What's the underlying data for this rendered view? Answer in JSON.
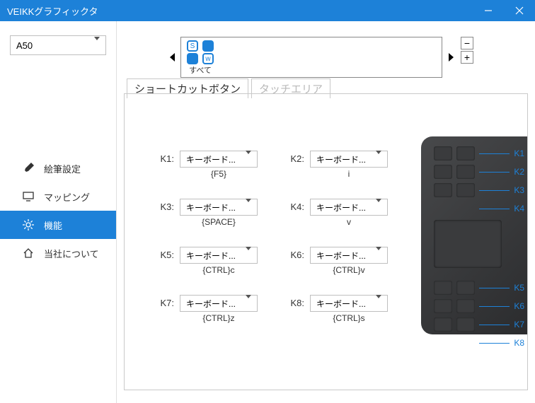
{
  "window": {
    "title": "VEIKKグラフィックタ"
  },
  "device": {
    "selected": "A50"
  },
  "sidebar": {
    "items": [
      {
        "label": "絵筆設定"
      },
      {
        "label": "マッピング"
      },
      {
        "label": "機能"
      },
      {
        "label": "当社について"
      }
    ]
  },
  "appbar": {
    "all_label": "すべて"
  },
  "tabs": {
    "shortcut": "ショートカットボタン",
    "touch": "タッチエリア"
  },
  "keys": {
    "option_label": "キーボード...",
    "k1": {
      "label": "K1:",
      "value": "{F5}"
    },
    "k2": {
      "label": "K2:",
      "value": "i"
    },
    "k3": {
      "label": "K3:",
      "value": "{SPACE}"
    },
    "k4": {
      "label": "K4:",
      "value": "v"
    },
    "k5": {
      "label": "K5:",
      "value": "{CTRL}c"
    },
    "k6": {
      "label": "K6:",
      "value": "{CTRL}v"
    },
    "k7": {
      "label": "K7:",
      "value": "{CTRL}z"
    },
    "k8": {
      "label": "K8:",
      "value": "{CTRL}s"
    }
  },
  "tablet_labels": [
    "K1",
    "K2",
    "K3",
    "K4",
    "K5",
    "K6",
    "K7",
    "K8"
  ]
}
